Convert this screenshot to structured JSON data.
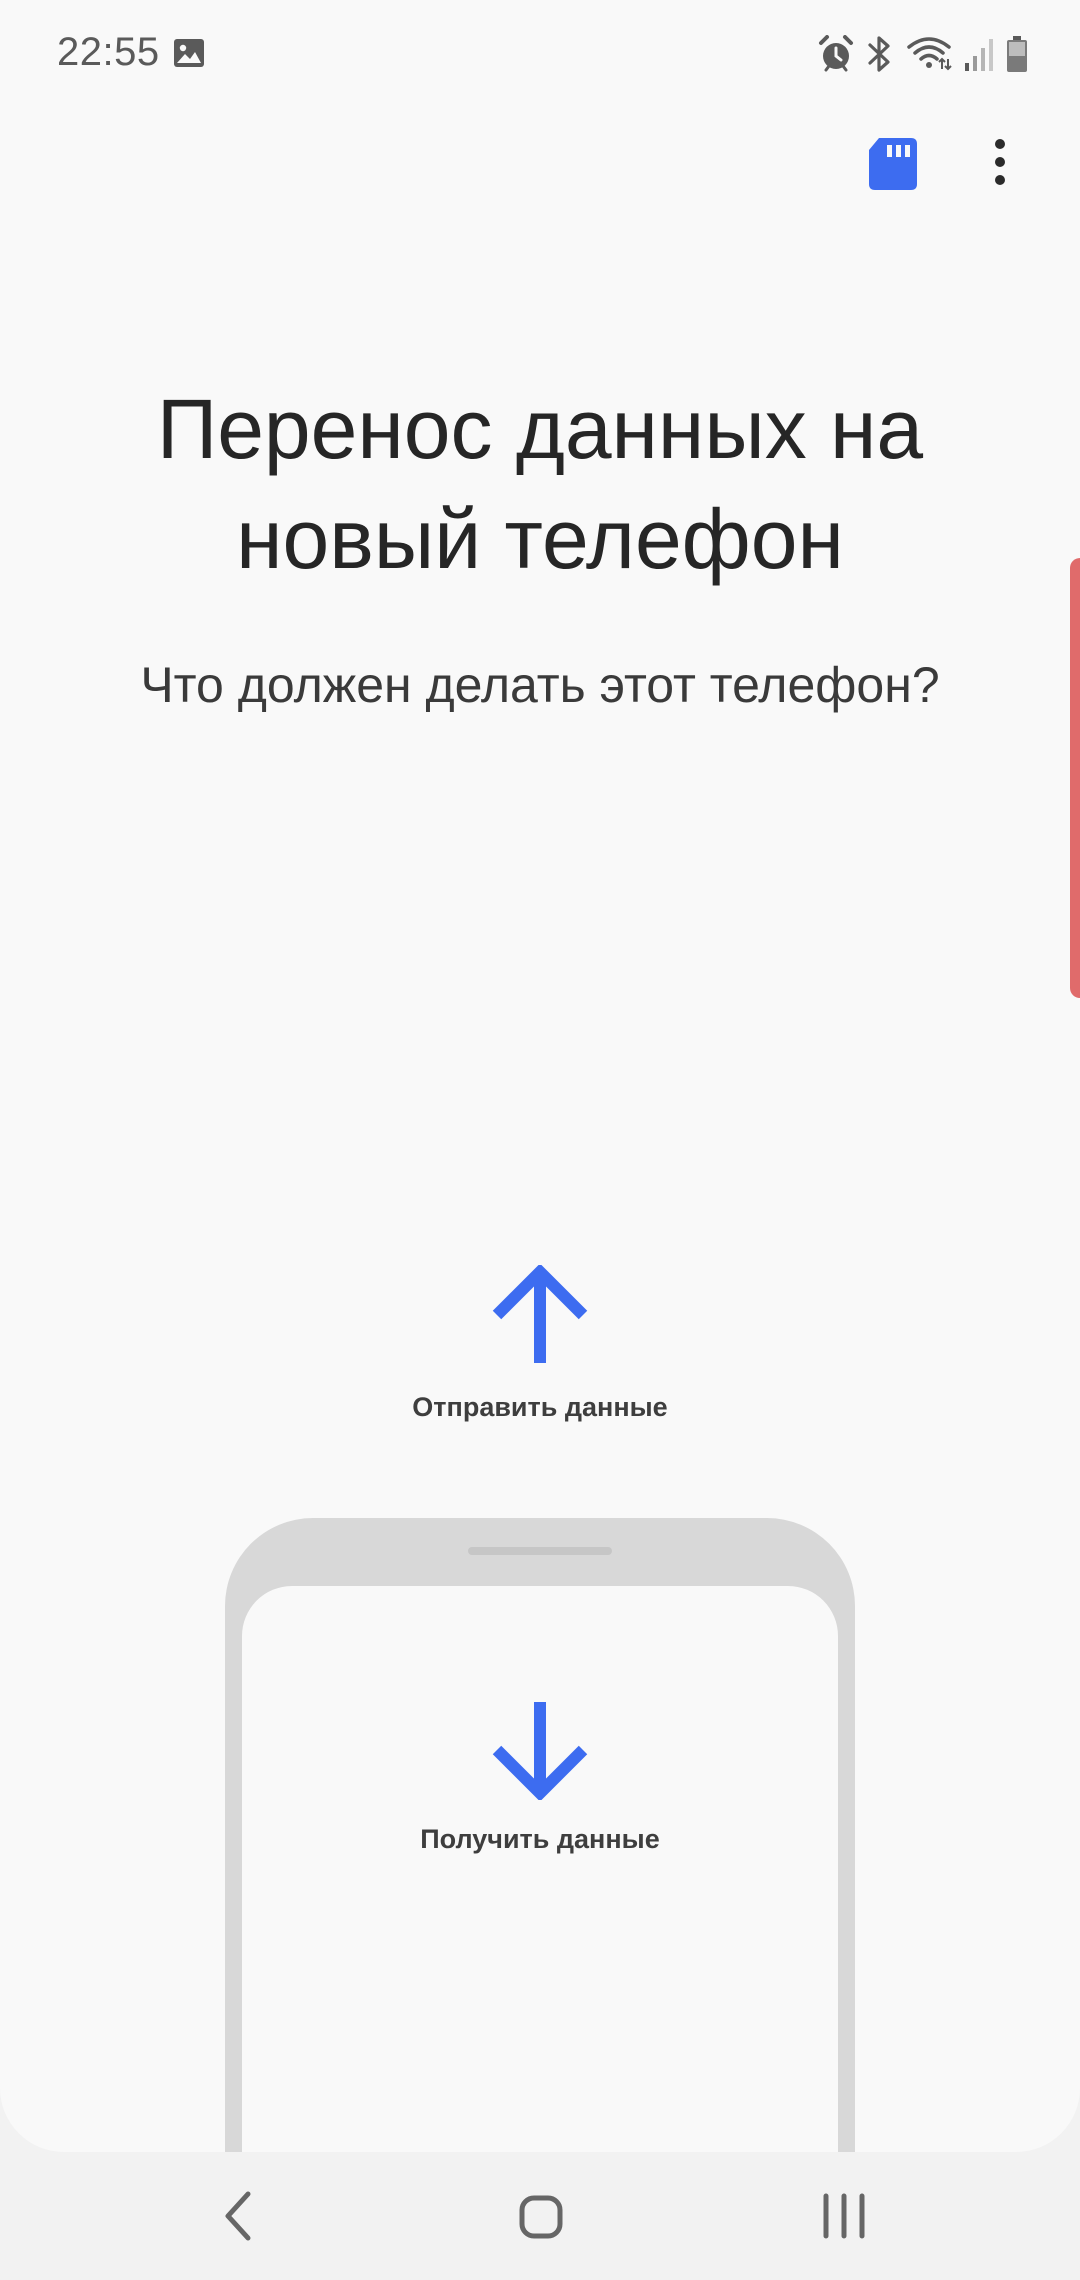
{
  "status_bar": {
    "time": "22:55",
    "icons": [
      "gallery-icon",
      "alarm-icon",
      "bluetooth-icon",
      "wifi-icon",
      "signal-icon",
      "battery-icon"
    ]
  },
  "toolbar": {
    "sdcard_icon": "sd-card-icon",
    "more_icon": "more-options-icon"
  },
  "main": {
    "title": "Перенос данных на новый телефон",
    "subtitle": "Что должен делать этот телефон?"
  },
  "options": {
    "send_label": "Отправить данные",
    "receive_label": "Получить данные"
  },
  "nav_bar": {
    "back_icon": "back-icon",
    "home_icon": "home-icon",
    "recents_icon": "recents-icon"
  },
  "colors": {
    "accent": "#3d6cf0",
    "background": "#f9f9f9",
    "phone_frame": "#d8d8d8",
    "edge_handle": "#e06b6b"
  }
}
